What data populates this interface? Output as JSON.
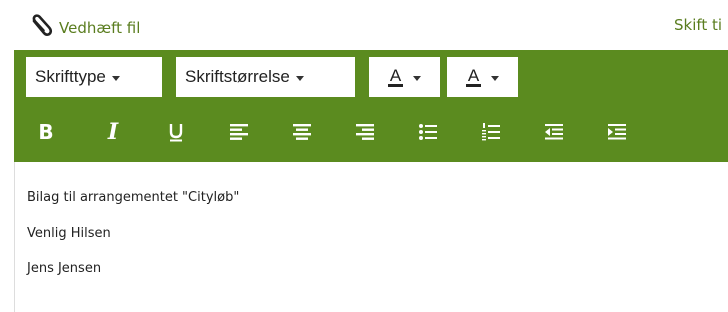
{
  "header": {
    "attach_label": "Vedhæft fil",
    "switch_label": "Skift ti",
    "link_color": "#5a7d1f"
  },
  "toolbar": {
    "background": "#5b8b1f",
    "font_family_select": "Skrifttype",
    "font_size_select": "Skriftstørrelse",
    "text_color_letter": "A",
    "background_color_letter": "A",
    "buttons": [
      "bold",
      "italic",
      "underline",
      "align-left",
      "align-center",
      "align-right",
      "bulleted-list",
      "numbered-list",
      "outdent",
      "indent"
    ],
    "bold_glyph": "B",
    "italic_glyph": "I"
  },
  "editor": {
    "lines": [
      "Bilag til arrangementet \"Cityløb\"",
      "Venlig Hilsen",
      "Jens Jensen"
    ]
  }
}
